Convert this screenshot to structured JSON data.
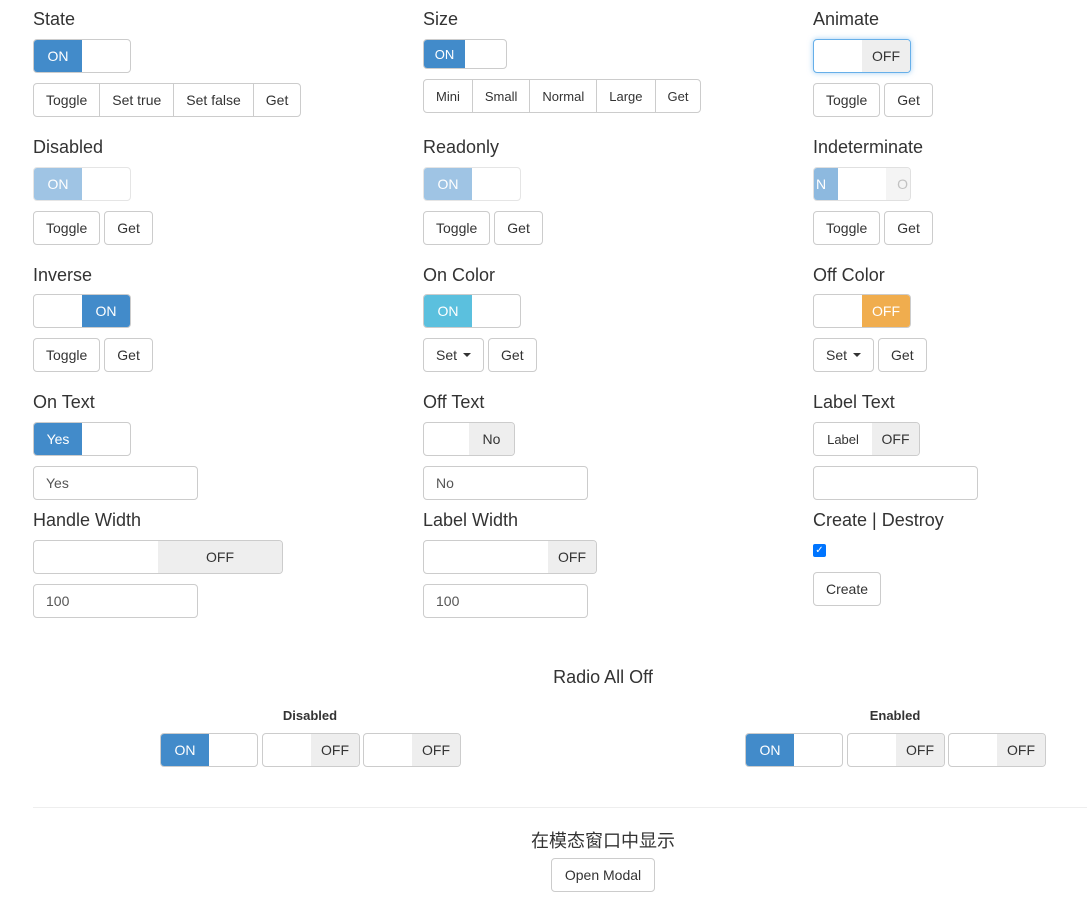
{
  "sections": {
    "state": {
      "title": "State",
      "switch_on": "ON",
      "buttons": [
        "Toggle",
        "Set true",
        "Set false",
        "Get"
      ]
    },
    "size": {
      "title": "Size",
      "switch_on": "ON",
      "buttons": [
        "Mini",
        "Small",
        "Normal",
        "Large",
        "Get"
      ]
    },
    "animate": {
      "title": "Animate",
      "switch_off": "OFF",
      "buttons": [
        "Toggle",
        "Get"
      ]
    },
    "disabled": {
      "title": "Disabled",
      "switch_on": "ON",
      "buttons": [
        "Toggle",
        "Get"
      ]
    },
    "readonly": {
      "title": "Readonly",
      "switch_on": "ON",
      "buttons": [
        "Toggle",
        "Get"
      ]
    },
    "indeterminate": {
      "title": "Indeterminate",
      "switch_on": "N",
      "switch_off": "O",
      "buttons": [
        "Toggle",
        "Get"
      ]
    },
    "inverse": {
      "title": "Inverse",
      "switch_on": "ON",
      "buttons": [
        "Toggle",
        "Get"
      ]
    },
    "on_color": {
      "title": "On Color",
      "switch_on": "ON",
      "buttons": [
        "Set",
        "Get"
      ]
    },
    "off_color": {
      "title": "Off Color",
      "switch_off": "OFF",
      "buttons": [
        "Set",
        "Get"
      ]
    },
    "on_text": {
      "title": "On Text",
      "switch_on": "Yes",
      "input_value": "Yes"
    },
    "off_text": {
      "title": "Off Text",
      "switch_off": "No",
      "input_value": "No"
    },
    "label_text": {
      "title": "Label Text",
      "switch_label": "Label",
      "switch_off": "OFF",
      "input_value": ""
    },
    "handle_width": {
      "title": "Handle Width",
      "switch_off": "OFF",
      "input_value": "100"
    },
    "label_width": {
      "title": "Label Width",
      "switch_off": "OFF",
      "input_value": "100"
    },
    "create_destroy": {
      "title": "Create | Destroy",
      "checked": true,
      "button": "Create"
    }
  },
  "radio_all_off": {
    "title": "Radio All Off",
    "disabled_group": {
      "label": "Disabled",
      "switches": [
        "ON",
        "OFF",
        "OFF"
      ]
    },
    "enabled_group": {
      "label": "Enabled",
      "switches": [
        "ON",
        "OFF",
        "OFF"
      ]
    }
  },
  "modal": {
    "title": "在模态窗口中显示",
    "button": "Open Modal"
  },
  "colors": {
    "primary": "#428bca",
    "info": "#5bc0de",
    "warning": "#f0ad4e",
    "default_off": "#eeeeee"
  }
}
